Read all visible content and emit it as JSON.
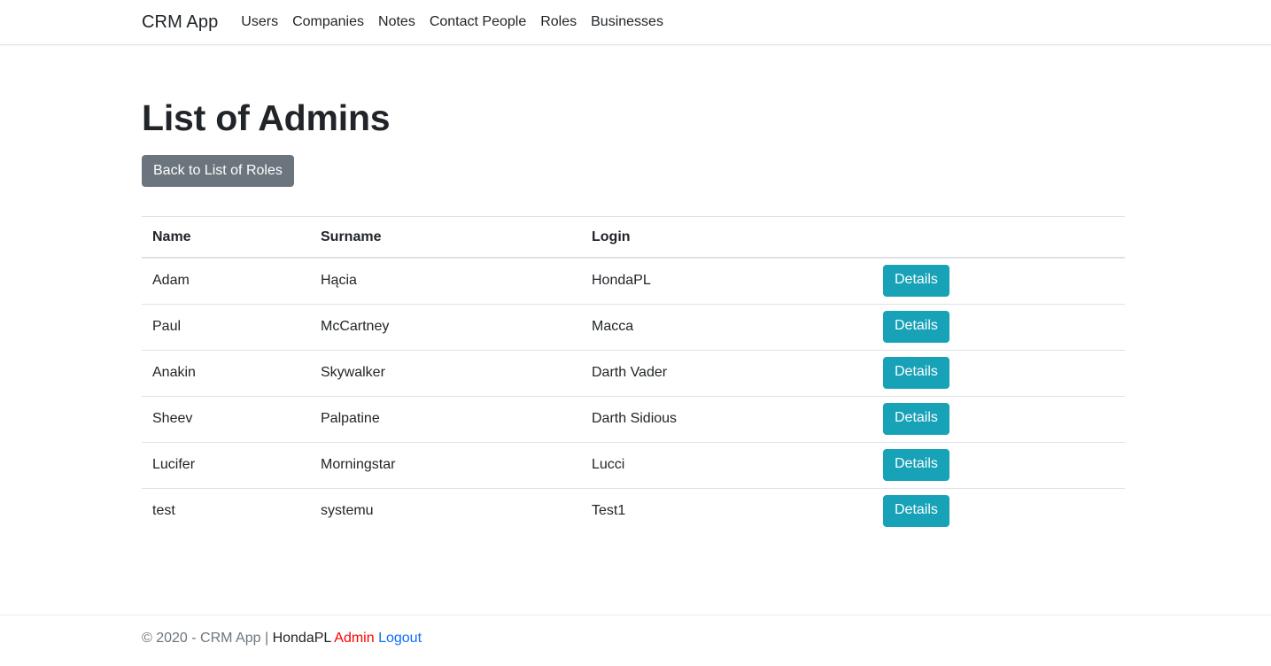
{
  "navbar": {
    "brand": "CRM App",
    "links": [
      {
        "label": "Users"
      },
      {
        "label": "Companies"
      },
      {
        "label": "Notes"
      },
      {
        "label": "Contact People"
      },
      {
        "label": "Roles"
      },
      {
        "label": "Businesses"
      }
    ]
  },
  "page": {
    "title": "List of Admins",
    "back_button": "Back to List of Roles"
  },
  "table": {
    "headers": [
      "Name",
      "Surname",
      "Login",
      ""
    ],
    "action_label": "Details",
    "rows": [
      {
        "name": "Adam",
        "surname": "Hącia",
        "login": "HondaPL",
        "action": "Details"
      },
      {
        "name": "Paul",
        "surname": "McCartney",
        "login": "Macca",
        "action": "Details"
      },
      {
        "name": "Anakin",
        "surname": "Skywalker",
        "login": "Darth Vader",
        "action": "Details"
      },
      {
        "name": "Sheev",
        "surname": "Palpatine",
        "login": "Darth Sidious",
        "action": "Details"
      },
      {
        "name": "Lucifer",
        "surname": "Morningstar",
        "login": "Lucci",
        "action": "Details"
      },
      {
        "name": "test",
        "surname": "systemu",
        "login": "Test1",
        "action": "Details"
      }
    ]
  },
  "footer": {
    "copyright": "© 2020 - CRM App",
    "separator": "|",
    "user": "HondaPL",
    "role": "Admin",
    "logout": "Logout"
  },
  "colors": {
    "info": "#17a2b8",
    "secondary": "#6c757d",
    "role_red": "#ff0000",
    "link_blue": "#0d6efd",
    "border": "#dee2e6",
    "text": "#212529"
  }
}
